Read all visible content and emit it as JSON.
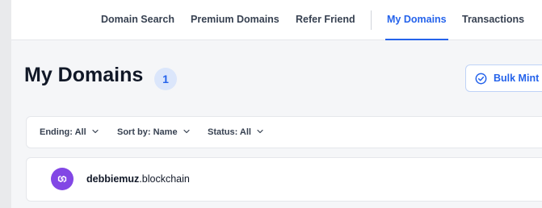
{
  "nav": {
    "items": [
      {
        "label": "Domain Search",
        "active": false
      },
      {
        "label": "Premium Domains",
        "active": false
      },
      {
        "label": "Refer Friend",
        "active": false
      },
      {
        "label": "My Domains",
        "active": true
      },
      {
        "label": "Transactions",
        "active": false
      }
    ]
  },
  "page": {
    "title": "My Domains",
    "count": "1",
    "bulk_button": {
      "label": "Bulk Mint",
      "icon": "check-circle-icon"
    }
  },
  "filters": [
    {
      "label": "Ending: All",
      "icon": "chevron-down-icon"
    },
    {
      "label": "Sort by: Name",
      "icon": "chevron-down-icon"
    },
    {
      "label": "Status: All",
      "icon": "chevron-down-icon"
    }
  ],
  "domains": [
    {
      "name": "debbiemuz",
      "tld": ".blockchain",
      "icon": "polygon-icon"
    }
  ],
  "colors": {
    "accent": "#2563eb",
    "badge_bg": "#dbe6fb",
    "polygon": "#8247e5",
    "page_bg": "#f5f6f8"
  }
}
